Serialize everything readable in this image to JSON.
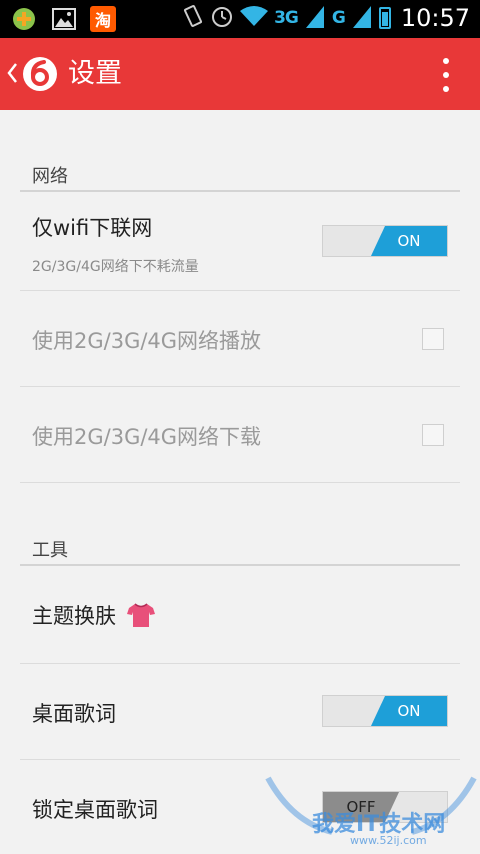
{
  "status_bar": {
    "taobao_label": "淘",
    "net1": "3G",
    "net2": "G",
    "time": "10:57",
    "icons": [
      "plus-circle-icon",
      "image-icon",
      "taobao-icon",
      "vibrate-icon",
      "alarm-icon",
      "wifi-icon",
      "signal-icon",
      "signal-icon",
      "battery-icon"
    ]
  },
  "app_bar": {
    "title": "设置",
    "accent": "#e83838"
  },
  "sections": {
    "network": {
      "header": "网络"
    },
    "tools": {
      "header": "工具"
    }
  },
  "settings": {
    "wifi_only": {
      "title": "仅wifi下联网",
      "subtitle": "2G/3G/4G网络下不耗流量",
      "state": "ON"
    },
    "play_mobile": {
      "title": "使用2G/3G/4G网络播放"
    },
    "download_mobile": {
      "title": "使用2G/3G/4G网络下载"
    },
    "theme": {
      "title": "主题换肤"
    },
    "desktop_lyrics": {
      "title": "桌面歌词",
      "state": "ON"
    },
    "lock_desktop_lyrics": {
      "title": "锁定桌面歌词",
      "state": "OFF"
    }
  },
  "watermark": {
    "text": "我爱IT技术网",
    "sub": "www.52ij.com"
  },
  "colors": {
    "toggle_on": "#1e9fd8",
    "toggle_off": "#8c8c8c"
  }
}
